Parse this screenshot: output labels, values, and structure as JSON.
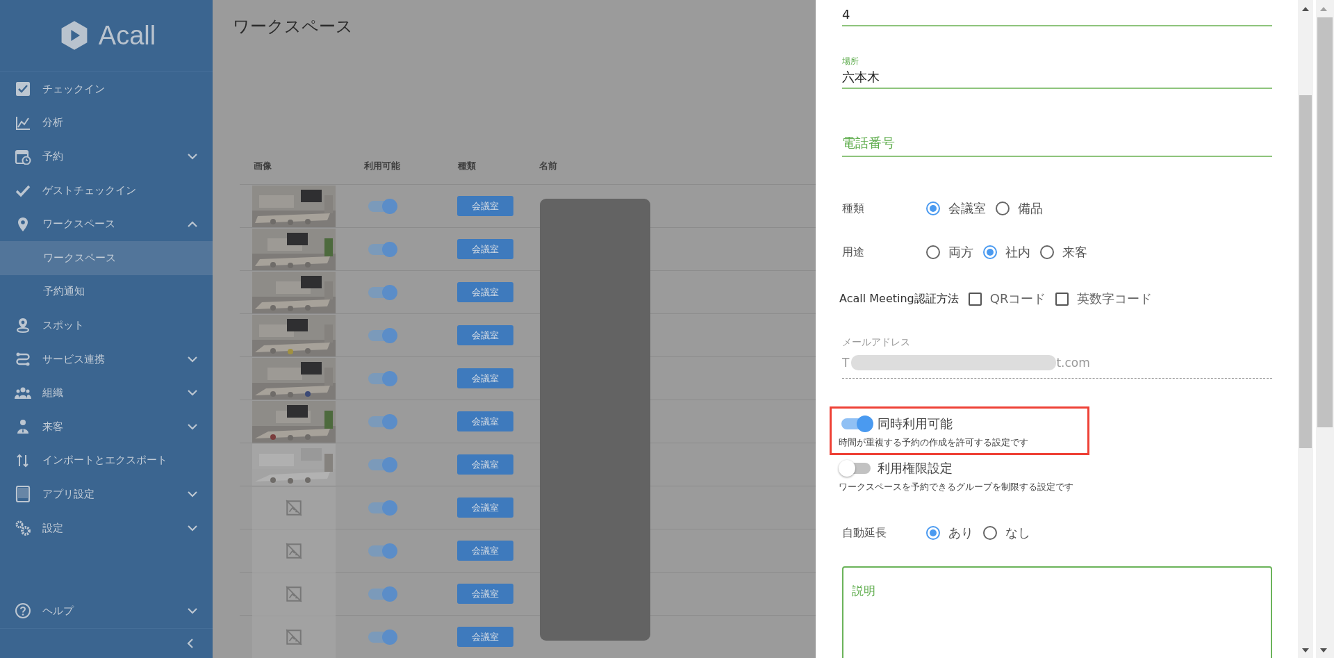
{
  "sidebar": {
    "logo": "Acall",
    "items": [
      {
        "kind": "checkin",
        "label": "チェックイン"
      },
      {
        "kind": "analytics",
        "label": "分析"
      },
      {
        "kind": "reservation",
        "label": "予約",
        "expanded": false
      },
      {
        "kind": "guest",
        "label": "ゲストチェックイン"
      },
      {
        "kind": "workspace",
        "label": "ワークスペース",
        "expanded": true,
        "children": [
          {
            "label": "ワークスペース",
            "selected": true
          },
          {
            "label": "予約通知",
            "selected": false
          }
        ]
      },
      {
        "kind": "spot",
        "label": "スポット"
      },
      {
        "kind": "integration",
        "label": "サービス連携",
        "expanded": false
      },
      {
        "kind": "organization",
        "label": "組織",
        "expanded": false
      },
      {
        "kind": "visitor",
        "label": "来客",
        "expanded": false
      },
      {
        "kind": "import",
        "label": "インポートとエクスポート"
      },
      {
        "kind": "app",
        "label": "アプリ設定",
        "expanded": false
      },
      {
        "kind": "settings",
        "label": "設定",
        "expanded": false
      }
    ],
    "help": {
      "label": "ヘルプ",
      "expanded": false
    }
  },
  "page": {
    "title": "ワークスペース"
  },
  "table": {
    "columns": [
      "画像",
      "利用可能",
      "種類",
      "名前"
    ],
    "rows": [
      {
        "kind": "picture",
        "available": true,
        "type": "会議室"
      },
      {
        "kind": "picture",
        "available": true,
        "type": "会議室"
      },
      {
        "kind": "picture",
        "available": true,
        "type": "会議室"
      },
      {
        "kind": "picture",
        "available": true,
        "type": "会議室"
      },
      {
        "kind": "picture",
        "available": true,
        "type": "会議室"
      },
      {
        "kind": "picture",
        "available": true,
        "type": "会議室"
      },
      {
        "kind": "picture",
        "available": true,
        "type": "会議室"
      },
      {
        "kind": "no_image",
        "available": true,
        "type": "会議室"
      },
      {
        "kind": "no_image",
        "available": true,
        "type": "会議室"
      },
      {
        "kind": "no_image",
        "available": true,
        "type": "会議室"
      },
      {
        "kind": "no_image",
        "available": true,
        "type": "会議室"
      }
    ]
  },
  "panel": {
    "fields": [
      {
        "value": "4"
      },
      {
        "label": "場所",
        "value": "六本木"
      },
      {
        "placeholder": "電話番号"
      }
    ],
    "type_group": {
      "label": "種類",
      "options": [
        {
          "label": "会議室",
          "selected": true
        },
        {
          "label": "備品",
          "selected": false
        }
      ]
    },
    "use_group": {
      "label": "用途",
      "options": [
        {
          "label": "両方",
          "selected": false
        },
        {
          "label": "社内",
          "selected": true
        },
        {
          "label": "来客",
          "selected": false
        }
      ]
    },
    "auth_group": {
      "label": "Acall Meeting認証方法",
      "options": [
        {
          "label": "QRコード",
          "checked": false
        },
        {
          "label": "英数字コード",
          "checked": false
        }
      ]
    },
    "email": {
      "label": "メールアドレス",
      "value_start": "T",
      "value_end": "t.com",
      "disabled": true
    },
    "toggles": [
      {
        "label": "同時利用可能",
        "description": "時間が重複する予約の作成を許可する設定です",
        "on": true,
        "highlighted": true
      },
      {
        "label": "利用権限設定",
        "description": "ワークスペースを予約できるグループを制限する設定です",
        "on": false,
        "highlighted": false
      }
    ],
    "extend_group": {
      "label": "自動延長",
      "options": [
        {
          "label": "あり",
          "selected": true
        },
        {
          "label": "なし",
          "selected": false
        }
      ]
    },
    "description": {
      "label": "説明"
    }
  }
}
